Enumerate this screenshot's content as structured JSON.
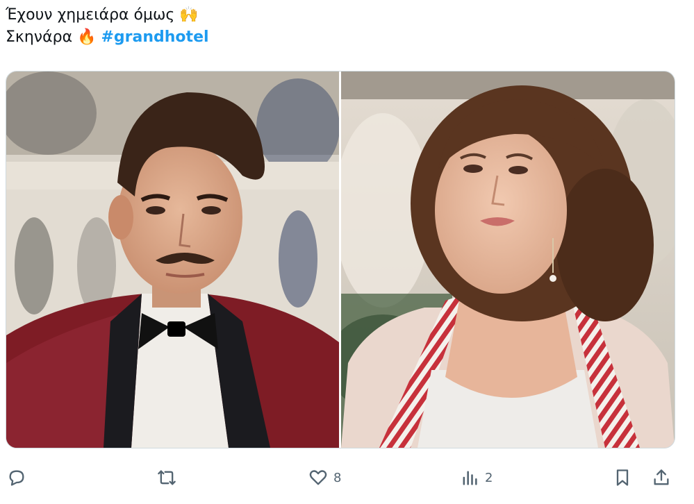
{
  "tweet": {
    "line1_text": "Έχουν χημειάρα όμως",
    "line1_emoji": "🙌",
    "line2_text": "Σκηνάρα",
    "line2_emoji": "🔥",
    "hashtag": "#grandhotel"
  },
  "media": {
    "left_photo": "man-in-red-velvet-jacket-and-bow-tie",
    "right_photo": "woman-with-curly-hair-and-striped-scarf"
  },
  "actions": {
    "reply_count": "",
    "repost_count": "",
    "like_count": "8",
    "views_count": "2"
  },
  "icons": {
    "reply": "reply-icon",
    "repost": "repost-icon",
    "like": "heart-icon",
    "views": "views-chart-icon",
    "bookmark": "bookmark-icon",
    "share": "share-icon"
  },
  "colors": {
    "hashtag": "#1d9bf0",
    "action_gray": "#536471",
    "text": "#0f1419"
  }
}
